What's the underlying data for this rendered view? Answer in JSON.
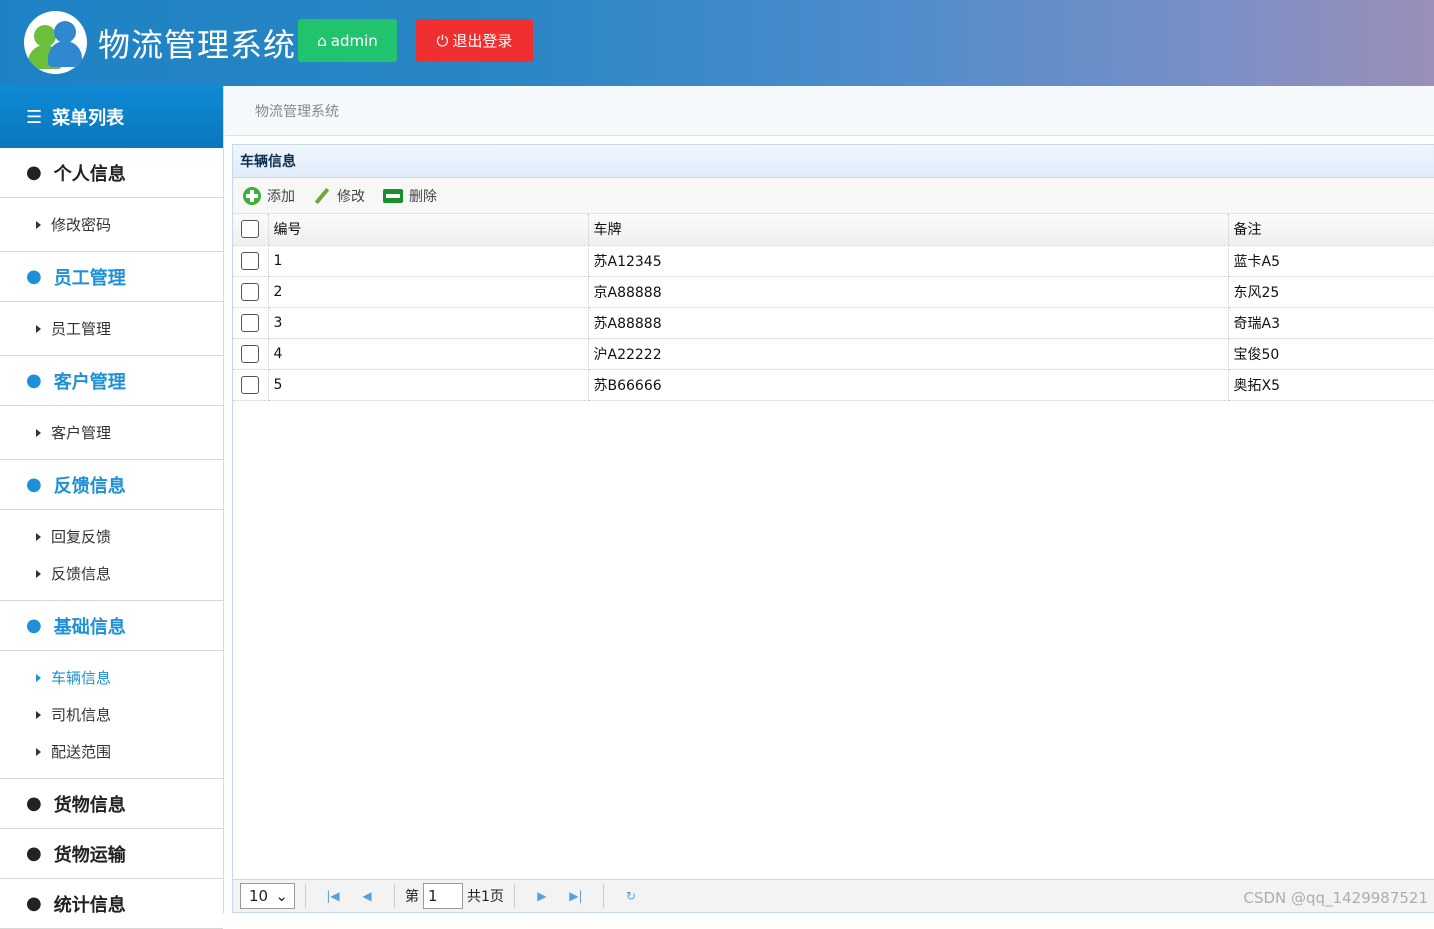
{
  "header": {
    "title": "物流管理系统",
    "admin_label": "admin",
    "logout_label": "退出登录",
    "colors": {
      "admin": "#21c36f",
      "logout": "#f02f30"
    }
  },
  "sidebar": {
    "menu_title": "菜单列表",
    "groups": [
      {
        "label": "个人信息",
        "items": [
          "修改密码"
        ]
      },
      {
        "label": "员工管理",
        "items": [
          "员工管理"
        ]
      },
      {
        "label": "客户管理",
        "items": [
          "客户管理"
        ]
      },
      {
        "label": "反馈信息",
        "items": [
          "回复反馈",
          "反馈信息"
        ]
      },
      {
        "label": "基础信息",
        "items": [
          "车辆信息",
          "司机信息",
          "配送范围"
        ]
      },
      {
        "label": "货物信息",
        "items": []
      },
      {
        "label": "货物运输",
        "items": []
      },
      {
        "label": "统计信息",
        "items": []
      }
    ],
    "active_item": "车辆信息"
  },
  "breadcrumb": "物流管理系统",
  "panel": {
    "title": "车辆信息",
    "toolbar": {
      "add": "添加",
      "edit": "修改",
      "delete": "删除"
    },
    "columns": [
      "编号",
      "车牌",
      "备注"
    ],
    "rows": [
      [
        "1",
        "苏A12345",
        "蓝卡A5"
      ],
      [
        "2",
        "京A88888",
        "东风25"
      ],
      [
        "3",
        "苏A88888",
        "奇瑞A3"
      ],
      [
        "4",
        "沪A22222",
        "宝俊50"
      ],
      [
        "5",
        "苏B66666",
        "奥拓X5"
      ]
    ]
  },
  "pager": {
    "page_size": "10",
    "page_prefix": "第",
    "current_page": "1",
    "total_pages": "共1页"
  },
  "watermark": "CSDN @qq_1429987521"
}
